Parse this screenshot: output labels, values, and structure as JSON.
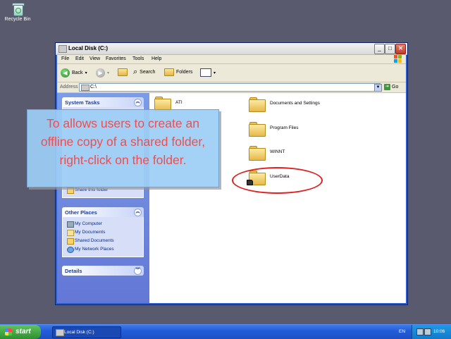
{
  "desktop": {
    "recycle_bin_label": "Recycle Bin"
  },
  "window": {
    "title": "Local Disk (C:)",
    "menu": [
      "File",
      "Edit",
      "View",
      "Favorites",
      "Tools",
      "Help"
    ],
    "toolbar": {
      "back_label": "Back",
      "search_label": "Search",
      "folders_label": "Folders"
    },
    "address": {
      "label": "Address",
      "value": "C:\\",
      "go_label": "Go"
    },
    "task_pane": {
      "system_tasks": {
        "title": "System Tasks",
        "items": [
          "Share this folder"
        ]
      },
      "other_places": {
        "title": "Other Places",
        "items": [
          "My Computer",
          "My Documents",
          "Shared Documents",
          "My Network Places"
        ]
      },
      "details": {
        "title": "Details"
      }
    },
    "folders": [
      {
        "name": "ATI"
      },
      {
        "name": "Documents and Settings"
      },
      {
        "name": "Program Files"
      },
      {
        "name": "WINNT"
      },
      {
        "name": "UserData",
        "shared": true,
        "highlighted": true
      }
    ]
  },
  "callout": {
    "text": "To allows users to create an offline copy of a shared folder, right-click on the folder."
  },
  "taskbar": {
    "start_label": "start",
    "task_button_label": "Local Disk (C:)",
    "language": "EN",
    "clock": "10:06"
  },
  "colors": {
    "callout_bg": "#9dcdf5",
    "callout_text": "#ef4e4e",
    "highlight_circle": "#e02020",
    "taskbar": "#245edb"
  }
}
